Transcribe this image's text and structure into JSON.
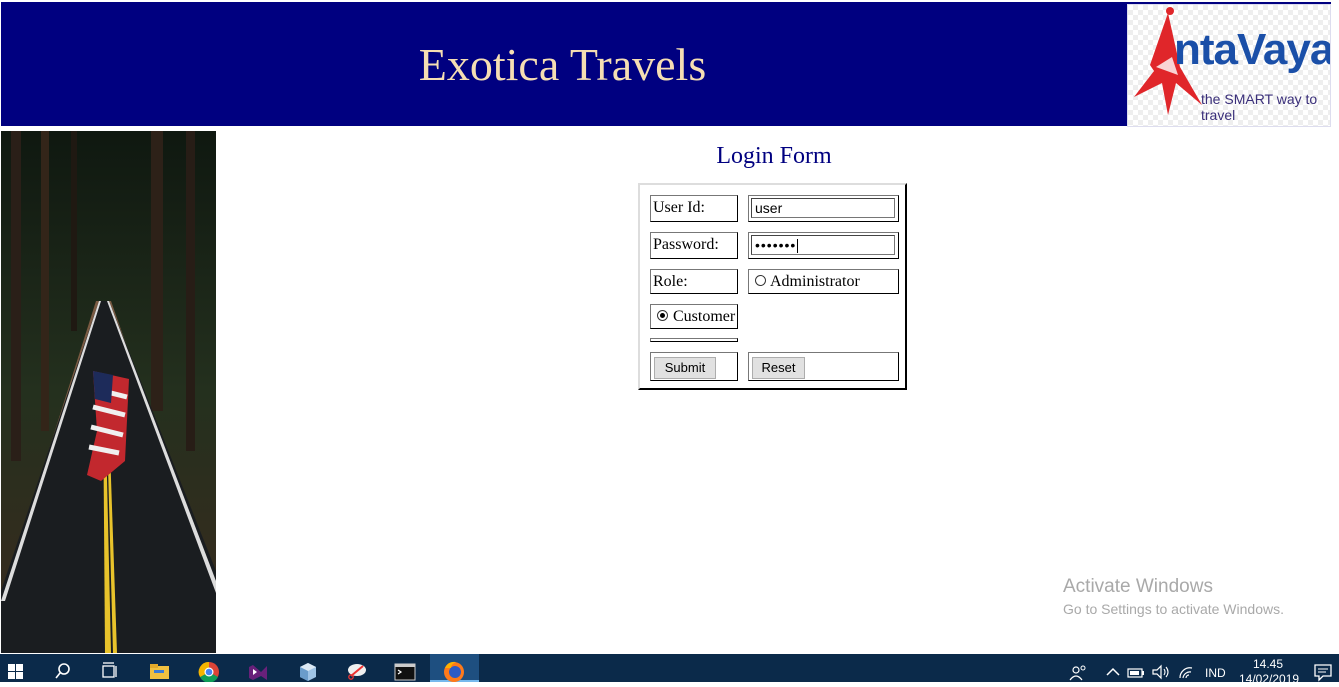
{
  "header": {
    "title": "Exotica Travels",
    "logo": {
      "brand": "ntaVaya",
      "tagline": "the SMART way to travel"
    }
  },
  "form": {
    "title": "Login Form",
    "user_id_label": "User Id:",
    "user_id_value": "user",
    "password_label": "Password:",
    "password_masked": "•••••••",
    "role_label": "Role:",
    "role_options": [
      {
        "label": "Administrator",
        "checked": false
      },
      {
        "label": "Customer",
        "checked": true
      }
    ],
    "submit_label": "Submit",
    "reset_label": "Reset"
  },
  "watermark": {
    "line1": "Activate Windows",
    "line2": "Go to Settings to activate Windows."
  },
  "taskbar": {
    "apps": [
      "start-icon",
      "search-icon",
      "task-view-icon",
      "file-explorer-icon",
      "chrome-icon",
      "visual-studio-icon",
      "virtualbox-icon",
      "snipping-tool-icon",
      "command-prompt-icon",
      "firefox-icon"
    ],
    "active_app": "firefox-icon",
    "language": "IND",
    "time": "14.45",
    "date": "14/02/2019"
  }
}
